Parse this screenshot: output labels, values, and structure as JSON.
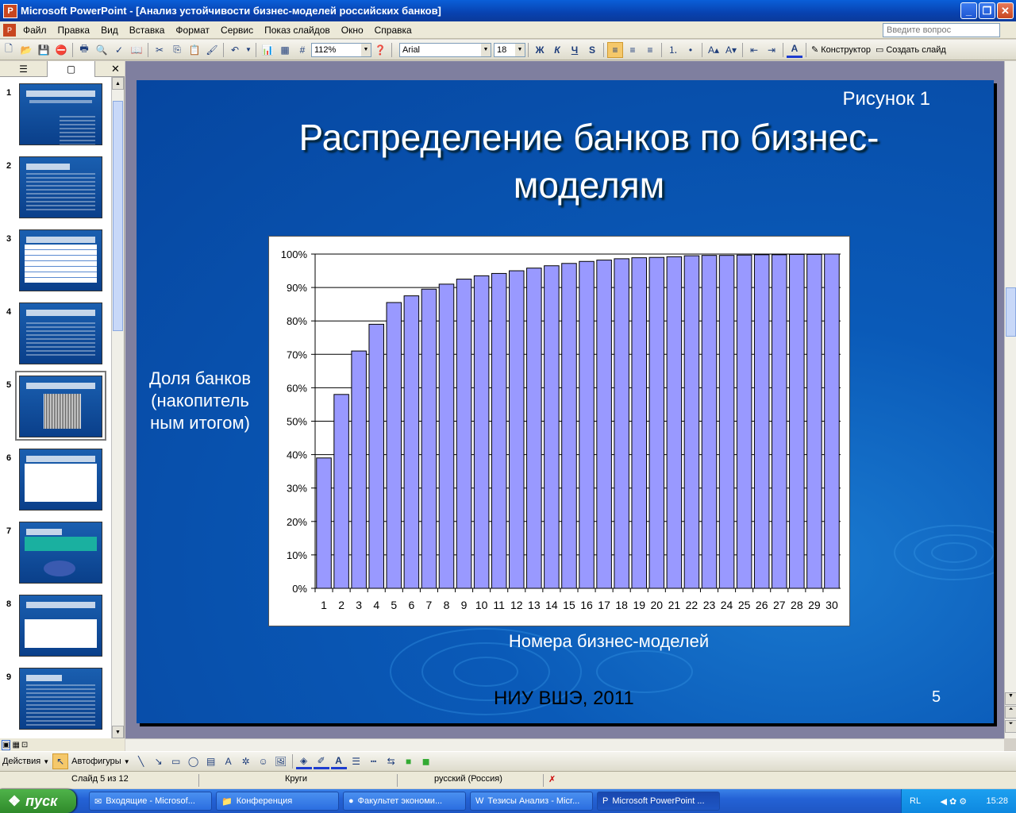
{
  "window": {
    "app_title": "Microsoft PowerPoint - [Анализ устойчивости бизнес-моделей российских банков]"
  },
  "menu": {
    "items": [
      "Файл",
      "Правка",
      "Вид",
      "Вставка",
      "Формат",
      "Сервис",
      "Показ слайдов",
      "Окно",
      "Справка"
    ],
    "help_placeholder": "Введите вопрос"
  },
  "toolbar": {
    "zoom": "112%",
    "font": "Arial",
    "font_size": "18",
    "bold": "Ж",
    "italic": "К",
    "underline": "Ч",
    "shadow": "S",
    "designer": "Конструктор",
    "new_slide": "Создать слайд"
  },
  "thumbnails": [
    {
      "num": "1",
      "style": "text"
    },
    {
      "num": "2",
      "style": "text"
    },
    {
      "num": "3",
      "style": "table"
    },
    {
      "num": "4",
      "style": "text"
    },
    {
      "num": "5",
      "style": "chart"
    },
    {
      "num": "6",
      "style": "table"
    },
    {
      "num": "7",
      "style": "pie"
    },
    {
      "num": "8",
      "style": "table"
    },
    {
      "num": "9",
      "style": "text"
    }
  ],
  "slide": {
    "figure_label": "Рисунок 1",
    "title": "Распределение банков по бизнес-моделям",
    "y_label": "Доля банков (накопитель ным итогом)",
    "x_label": "Номера бизнес-моделей",
    "footer": "НИУ ВШЭ, 2011",
    "page_number": "5"
  },
  "chart_data": {
    "type": "bar",
    "categories": [
      "1",
      "2",
      "3",
      "4",
      "5",
      "6",
      "7",
      "8",
      "9",
      "10",
      "11",
      "12",
      "13",
      "14",
      "15",
      "16",
      "17",
      "18",
      "19",
      "20",
      "21",
      "22",
      "23",
      "24",
      "25",
      "26",
      "27",
      "28",
      "29",
      "30"
    ],
    "values": [
      39,
      58,
      71,
      79,
      85.5,
      87.5,
      89.5,
      91,
      92.5,
      93.5,
      94.2,
      95,
      95.8,
      96.5,
      97.2,
      97.8,
      98.2,
      98.6,
      98.9,
      99,
      99.2,
      99.5,
      99.6,
      99.6,
      99.7,
      99.8,
      99.8,
      99.9,
      99.9,
      100
    ],
    "ylim": [
      0,
      100
    ],
    "y_ticks": [
      "0%",
      "10%",
      "20%",
      "30%",
      "40%",
      "50%",
      "60%",
      "70%",
      "80%",
      "90%",
      "100%"
    ],
    "grid": true,
    "bar_color": "#9999ff"
  },
  "drawbar": {
    "actions": "Действия",
    "autoshapes": "Автофигуры"
  },
  "status": {
    "slide_pos": "Слайд 5 из 12",
    "design": "Круги",
    "language": "русский (Россия)"
  },
  "taskbar": {
    "start": "пуск",
    "tasks": [
      "Входящие - Microsof...",
      "Конференция",
      "Факультет экономи...",
      "Тезисы Анализ - Micr...",
      "Microsoft PowerPoint ..."
    ],
    "lang": "RL",
    "clock": "15:28"
  }
}
